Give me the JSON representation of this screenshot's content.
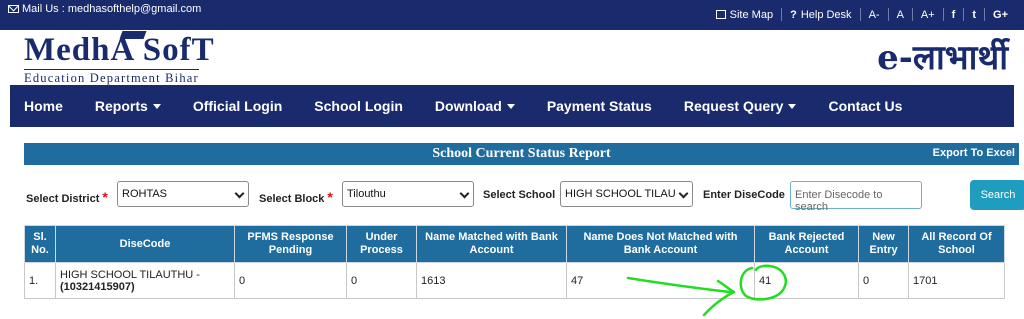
{
  "topbar": {
    "mail_label": "Mail Us : medhasofthelp@gmail.com",
    "links": [
      "Site Map",
      "Help Desk",
      "A-",
      "A",
      "A+"
    ],
    "social": [
      "f",
      "t",
      "G+"
    ]
  },
  "logo": {
    "title": "MedhA SofT",
    "subtitle": "Education Department Bihar",
    "brand_right": "e-लाभार्थी"
  },
  "nav": {
    "items": [
      "Home",
      "Reports",
      "Official Login",
      "School Login",
      "Download",
      "Payment Status",
      "Request Query",
      "Contact Us"
    ]
  },
  "report": {
    "title": "School Current Status Report",
    "export_label": "Export To Excel"
  },
  "filters": {
    "district_label": "Select District",
    "district_value": "ROHTAS",
    "block_label": "Select Block",
    "block_value": "Tilouthu",
    "school_label": "Select School",
    "school_value": "HIGH SCHOOL TILAU",
    "disecode_label": "Enter DiseCode",
    "disecode_placeholder": "Enter Disecode to search",
    "search_label": "Search"
  },
  "table": {
    "headers": [
      "Sl. No.",
      "DiseCode",
      "PFMS Response Pending",
      "Under Process",
      "Name Matched with Bank Account",
      "Name Does Not Matched with Bank Account",
      "Bank Rejected Account",
      "New Entry",
      "All Record Of School"
    ],
    "row": {
      "sl": "1.",
      "dise_name": "HIGH SCHOOL TILAUTHU -",
      "dise_code": "(10321415907)",
      "pfms": "0",
      "under_process": "0",
      "matched": "1613",
      "not_matched": "47",
      "rejected": "41",
      "new_entry": "0",
      "all_record": "1701"
    }
  },
  "colors": {
    "navy": "#1a2b6d",
    "report_blue": "#1f6c9f",
    "search_button": "#1f9dbf",
    "annotation": "#22dd22"
  }
}
